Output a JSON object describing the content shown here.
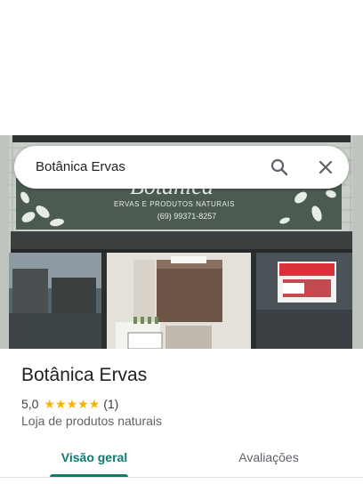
{
  "search": {
    "query": "Botânica Ervas",
    "search_icon": "search-icon",
    "close_icon": "close-icon"
  },
  "photo": {
    "sign_name": "Botânica",
    "sign_subtitle": "ERVAS E PRODUTOS NATURAIS",
    "sign_phone": "(69) 99371-8257"
  },
  "place": {
    "title": "Botânica Ervas",
    "rating": "5,0",
    "stars": "★★★★★",
    "review_count": "(1)",
    "category": "Loja de produtos naturais"
  },
  "tabs": [
    {
      "label": "Visão geral",
      "selected": true
    },
    {
      "label": "Avaliações",
      "selected": false
    }
  ],
  "colors": {
    "accent": "#0b7a6f",
    "star": "#f5b400",
    "sign_green": "#4c5b52"
  }
}
